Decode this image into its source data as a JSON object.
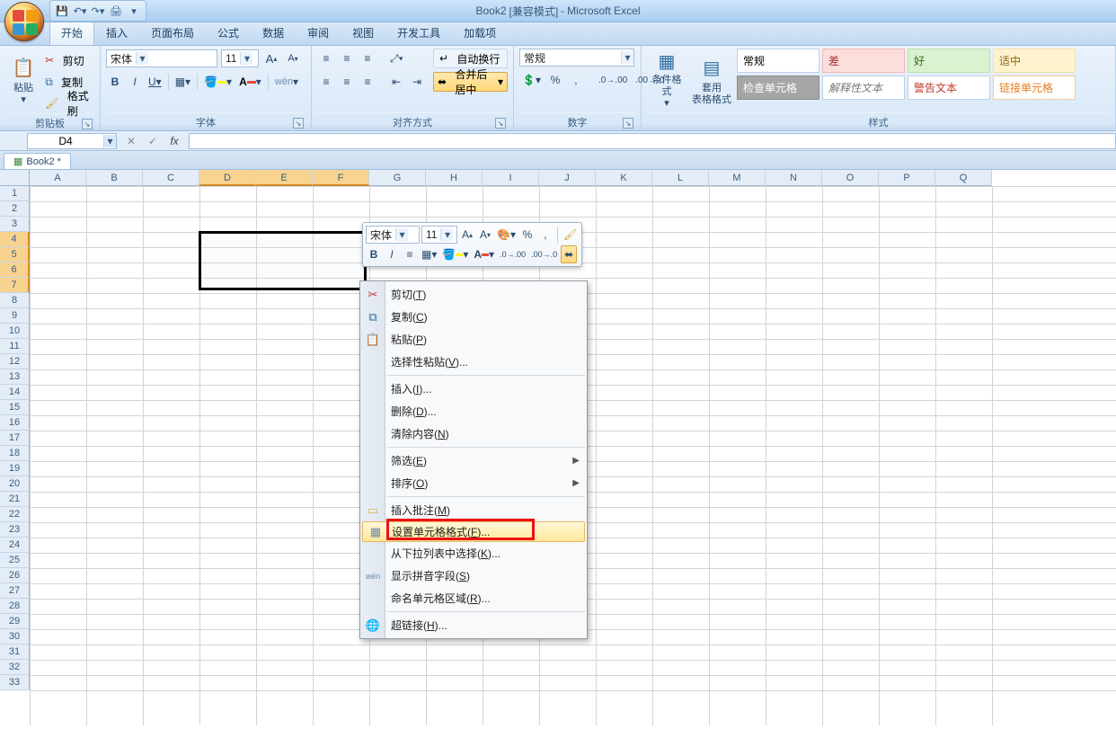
{
  "title": {
    "book": "Book2",
    "mode": "[兼容模式]",
    "app": "Microsoft Excel"
  },
  "tabs": [
    "开始",
    "插入",
    "页面布局",
    "公式",
    "数据",
    "审阅",
    "视图",
    "开发工具",
    "加载项"
  ],
  "active_tab_index": 0,
  "clipboard": {
    "paste": "粘贴",
    "cut": "剪切",
    "copy": "复制",
    "painter": "格式刷",
    "group": "剪贴板"
  },
  "font": {
    "name": "宋体",
    "size": "11",
    "group": "字体",
    "bold": "B",
    "italic": "I",
    "underline": "U"
  },
  "alignment": {
    "wrap": "自动换行",
    "merge": "合并后居中",
    "group": "对齐方式"
  },
  "number": {
    "format": "常规",
    "group": "数字",
    "percent": "%",
    "comma": ","
  },
  "styles": {
    "condfmt": "条件格式",
    "tablefmt": "套用\n表格格式",
    "group": "样式",
    "gallery": [
      {
        "t": "常规",
        "bg": "#ffffff",
        "fg": "#000",
        "bd": "#bcd2e8"
      },
      {
        "t": "差",
        "bg": "#fcdedc",
        "fg": "#a7302a",
        "bd": "#f2b7b3"
      },
      {
        "t": "好",
        "bg": "#d9f2d0",
        "fg": "#2f6b1e",
        "bd": "#b9e2ac"
      },
      {
        "t": "适中",
        "bg": "#fff3cf",
        "fg": "#8a6316",
        "bd": "#f2e2a6"
      },
      {
        "t": "检查单元格",
        "bg": "#a6a6a6",
        "fg": "#fff",
        "bd": "#8c8c8c"
      },
      {
        "t": "解释性文本",
        "bg": "#ffffff",
        "fg": "#7a7a7a",
        "it": true,
        "bd": "#bcd2e8"
      },
      {
        "t": "警告文本",
        "bg": "#ffffff",
        "fg": "#c0392b",
        "bd": "#bcd2e8"
      },
      {
        "t": "链接单元格",
        "bg": "#ffffff",
        "fg": "#e67e22",
        "bd": "#f2c99c"
      }
    ]
  },
  "namebox": "D4",
  "formula": "",
  "workbook_tab": "Book2 *",
  "columns": [
    "A",
    "B",
    "C",
    "D",
    "E",
    "F",
    "G",
    "H",
    "I",
    "J",
    "K",
    "L",
    "M",
    "N",
    "O",
    "P",
    "Q"
  ],
  "rows_count": 33,
  "selected_cols": [
    3,
    4,
    5
  ],
  "selected_rows": [
    4,
    5,
    6,
    7
  ],
  "selection_rect": {
    "c1": 3,
    "r1": 4,
    "c2": 5,
    "r2": 7
  },
  "minitoolbar": {
    "font": "宋体",
    "size": "11"
  },
  "context_menu": [
    {
      "t": "X",
      "label": "剪切(",
      "u": "T",
      "tail": ")",
      "ic": "✂",
      "c": "#c0392b"
    },
    {
      "t": "X",
      "label": "复制(",
      "u": "C",
      "tail": ")",
      "ic": "⧉",
      "c": "#2d6ca2"
    },
    {
      "t": "X",
      "label": "粘贴(",
      "u": "P",
      "tail": ")",
      "ic": "📋",
      "c": "#c28a2b"
    },
    {
      "t": "X",
      "label": "选择性粘贴(",
      "u": "V",
      "tail": ")..."
    },
    {
      "t": "S"
    },
    {
      "t": "X",
      "label": "插入(",
      "u": "I",
      "tail": ")..."
    },
    {
      "t": "X",
      "label": "删除(",
      "u": "D",
      "tail": ")..."
    },
    {
      "t": "X",
      "label": "清除内容(",
      "u": "N",
      "tail": ")"
    },
    {
      "t": "S"
    },
    {
      "t": "X",
      "label": "筛选(",
      "u": "E",
      "tail": ")",
      "sub": true
    },
    {
      "t": "X",
      "label": "排序(",
      "u": "O",
      "tail": ")",
      "sub": true
    },
    {
      "t": "S"
    },
    {
      "t": "X",
      "label": "插入批注(",
      "u": "M",
      "tail": ")",
      "ic": "▭",
      "c": "#d8b94e"
    },
    {
      "t": "X",
      "label": "设置单元格格式(",
      "u": "F",
      "tail": ")...",
      "ic": "▦",
      "c": "#6b8bab",
      "hl": true
    },
    {
      "t": "X",
      "label": "从下拉列表中选择(",
      "u": "K",
      "tail": ")..."
    },
    {
      "t": "X",
      "label": "显示拼音字段(",
      "u": "S",
      "tail": ")",
      "ic": "wén",
      "c": "#6b8bab",
      "txt": true
    },
    {
      "t": "X",
      "label": "命名单元格区域(",
      "u": "R",
      "tail": ")..."
    },
    {
      "t": "S"
    },
    {
      "t": "X",
      "label": "超链接(",
      "u": "H",
      "tail": ")...",
      "ic": "🌐",
      "c": "#2d6ca2"
    }
  ]
}
